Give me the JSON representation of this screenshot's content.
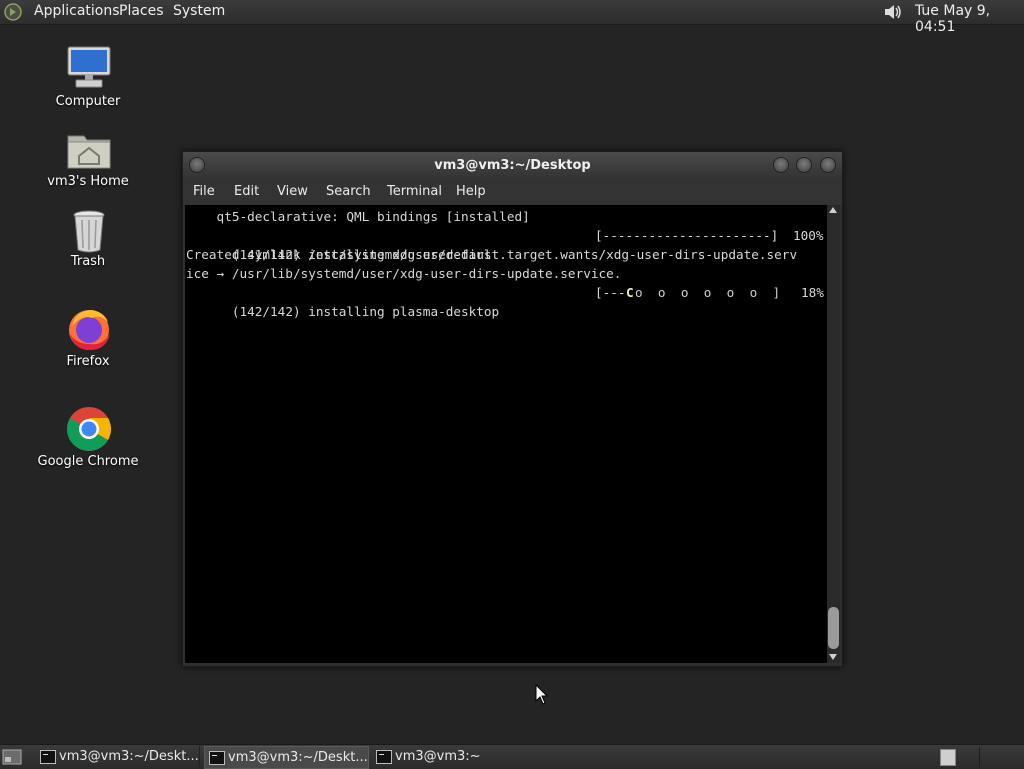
{
  "top_panel": {
    "menus": [
      "Applications",
      "Places",
      "System"
    ],
    "clock": "Tue May  9, 04:51",
    "icons": {
      "logo": "distro-logo-icon",
      "volume": "volume-icon"
    }
  },
  "desktop": {
    "icons": [
      {
        "label": "Computer",
        "icon": "computer-icon"
      },
      {
        "label": "vm3's Home",
        "icon": "home-folder-icon"
      },
      {
        "label": "Trash",
        "icon": "trash-icon"
      },
      {
        "label": "Firefox",
        "icon": "firefox-icon"
      },
      {
        "label": "Google Chrome",
        "icon": "chrome-icon"
      }
    ]
  },
  "terminal": {
    "title": "vm3@vm3:~/Desktop",
    "menus": [
      "File",
      "Edit",
      "View",
      "Search",
      "Terminal",
      "Help"
    ],
    "lines": [
      {
        "left": "    qt5-declarative: QML bindings [installed]",
        "right": ""
      },
      {
        "left": "(141/142) installing xdg-user-dirs",
        "bar": "[----------------------]",
        "pct": "100%"
      },
      {
        "left": "Created symlink /etc/systemd/user/default.target.wants/xdg-user-dirs-update.serv",
        "right": ""
      },
      {
        "left": "ice → /usr/lib/systemd/user/xdg-user-dirs-update.service.",
        "right": ""
      },
      {
        "left": "(142/142) installing plasma-desktop",
        "bar_start": "[---",
        "pacman": "C",
        "pellets": "o  o  o  o  o  o  ]",
        "pct": "18%"
      }
    ],
    "progress": {
      "xdg_user_dirs": 1.0,
      "plasma_desktop": 0.18
    }
  },
  "taskbar": {
    "tasks": [
      {
        "label": "vm3@vm3:~/Deskt...",
        "active": false
      },
      {
        "label": "vm3@vm3:~/Deskt...",
        "active": true
      },
      {
        "label": "vm3@vm3:~",
        "active": false
      }
    ],
    "icons": {
      "show_desktop": "show-desktop-icon",
      "task": "terminal-icon"
    }
  },
  "colors": {
    "desktop_bg": "#242424",
    "panel_bg": "#333333",
    "terminal_bg": "#000000",
    "terminal_fg": "#d8d8d8",
    "pacman": "#f2f2a0"
  }
}
